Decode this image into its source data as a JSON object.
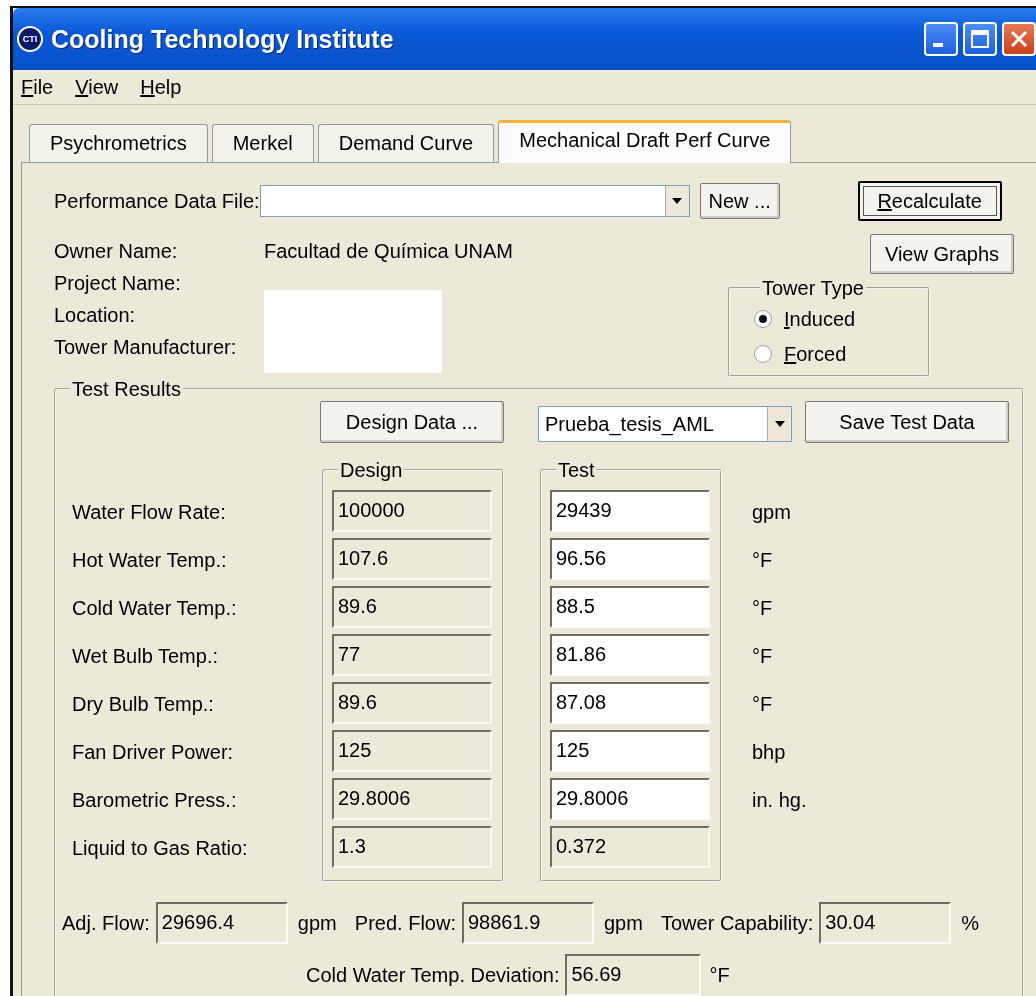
{
  "window": {
    "title": "Cooling Technology Institute",
    "logo": "CTI"
  },
  "menu": [
    "File",
    "View",
    "Help"
  ],
  "tabs": [
    {
      "label": "Psychrometrics",
      "selected": false
    },
    {
      "label": "Merkel",
      "selected": false
    },
    {
      "label": "Demand Curve",
      "selected": false
    },
    {
      "label": "Mechanical Draft Perf Curve",
      "selected": true
    }
  ],
  "performance_data_file": {
    "label": "Performance Data File:",
    "new_button": "New ..."
  },
  "buttons": {
    "recalculate": "Recalculate",
    "view_graphs": "View Graphs"
  },
  "info": [
    {
      "label": "Owner Name:",
      "value": "Facultad de Química UNAM"
    },
    {
      "label": "Project Name:"
    },
    {
      "label": "Location:"
    },
    {
      "label": "Tower Manufacturer:"
    }
  ],
  "tower_type": {
    "title": "Tower Type",
    "options": [
      {
        "label": "Induced",
        "selected": true
      },
      {
        "label": "Forced",
        "selected": false
      }
    ]
  },
  "test_results": {
    "title": "Test Results",
    "design_data_button": "Design Data ...",
    "test_select": "Prueba_tesis_AML",
    "save_button": "Save Test Data",
    "design_title": "Design",
    "test_title": "Test",
    "rows": [
      {
        "label": "Water Flow Rate:",
        "design": "100000",
        "test": "29439",
        "test_read_only": false,
        "unit": "gpm"
      },
      {
        "label": "Hot Water Temp.:",
        "design": "107.6",
        "test": "96.56",
        "test_read_only": false,
        "unit": "°F"
      },
      {
        "label": "Cold Water Temp.:",
        "design": "89.6",
        "test": "88.5",
        "test_read_only": false,
        "unit": "°F"
      },
      {
        "label": "Wet Bulb Temp.:",
        "design": "77",
        "test": "81.86",
        "test_read_only": false,
        "unit": "°F"
      },
      {
        "label": "Dry Bulb Temp.:",
        "design": "89.6",
        "test": "87.08",
        "test_read_only": false,
        "unit": "°F"
      },
      {
        "label": "Fan Driver Power:",
        "design": "125",
        "test": "125",
        "test_read_only": false,
        "unit": "bhp"
      },
      {
        "label": "Barometric Press.:",
        "design": "29.8006",
        "test": "29.8006",
        "test_read_only": false,
        "unit": "in. hg."
      },
      {
        "label": "Liquid to Gas Ratio:",
        "design": "1.3",
        "test": "0.372",
        "test_read_only": true
      }
    ],
    "outputs": [
      {
        "label": "Adj. Flow:",
        "value": "29696.4",
        "unit": "gpm"
      },
      {
        "label": "Pred. Flow:",
        "value": "98861.9",
        "unit": "gpm"
      },
      {
        "label": "Tower Capability:",
        "value": "30.04",
        "unit": "%"
      }
    ],
    "deviation": {
      "label": "Cold Water Temp. Deviation:",
      "value": "56.69",
      "unit": "°F"
    }
  }
}
